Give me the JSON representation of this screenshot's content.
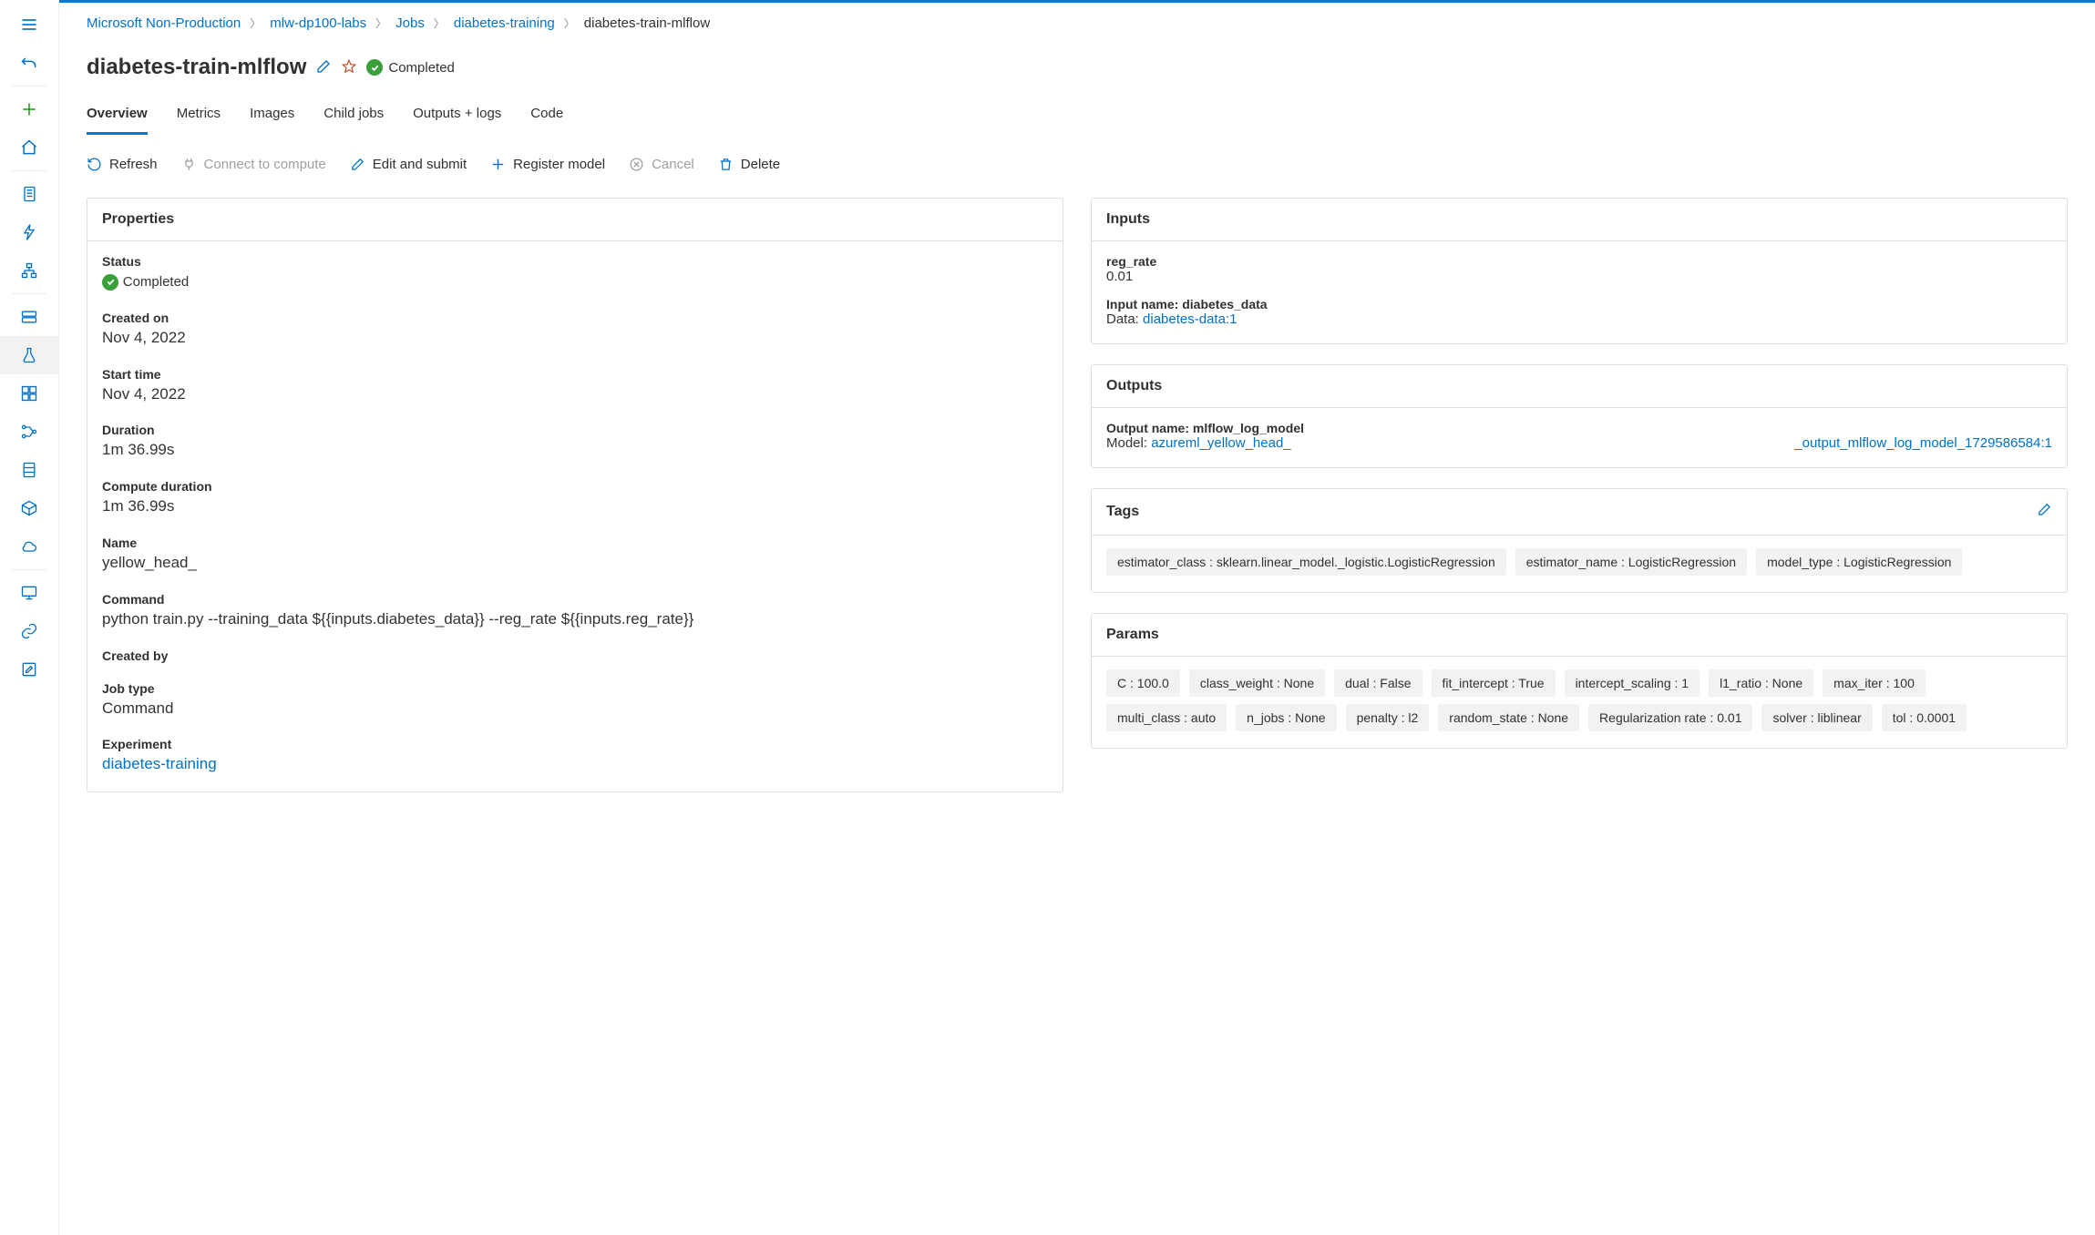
{
  "breadcrumb": [
    {
      "label": "Microsoft Non-Production",
      "link": true
    },
    {
      "label": "mlw-dp100-labs",
      "link": true
    },
    {
      "label": "Jobs",
      "link": true
    },
    {
      "label": "diabetes-training",
      "link": true
    },
    {
      "label": "diabetes-train-mlflow",
      "link": false
    }
  ],
  "title": "diabetes-train-mlflow",
  "status_label": "Completed",
  "tabs": {
    "overview": "Overview",
    "metrics": "Metrics",
    "images": "Images",
    "child_jobs": "Child jobs",
    "outputs_logs": "Outputs + logs",
    "code": "Code"
  },
  "actions": {
    "refresh": "Refresh",
    "connect": "Connect to compute",
    "edit_submit": "Edit and submit",
    "register_model": "Register model",
    "cancel": "Cancel",
    "delete": "Delete"
  },
  "headers": {
    "properties": "Properties",
    "inputs": "Inputs",
    "outputs": "Outputs",
    "tags": "Tags",
    "params": "Params"
  },
  "properties": {
    "status_label": "Status",
    "status_value": "Completed",
    "created_on_label": "Created on",
    "created_on_value": "Nov 4, 2022",
    "start_time_label": "Start time",
    "start_time_value": "Nov 4, 2022",
    "duration_label": "Duration",
    "duration_value": "1m 36.99s",
    "compute_duration_label": "Compute duration",
    "compute_duration_value": "1m 36.99s",
    "name_label": "Name",
    "name_value": "yellow_head_",
    "command_label": "Command",
    "command_value": "python train.py --training_data ${{inputs.diabetes_data}} --reg_rate ${{inputs.reg_rate}}",
    "created_by_label": "Created by",
    "created_by_value": "",
    "job_type_label": "Job type",
    "job_type_value": "Command",
    "experiment_label": "Experiment",
    "experiment_value": "diabetes-training"
  },
  "inputs": {
    "reg_rate_label": "reg_rate",
    "reg_rate_value": "0.01",
    "input_name_label": "Input name: diabetes_data",
    "data_prefix": "Data: ",
    "data_link": "diabetes-data:1"
  },
  "outputs": {
    "name_label": "Output name: mlflow_log_model",
    "model_prefix": "Model: ",
    "model_link_a": "azureml_yellow_head_",
    "model_link_b": "_output_mlflow_log_model_1729586584:1"
  },
  "tags_list": [
    "estimator_class : sklearn.linear_model._logistic.LogisticRegression",
    "estimator_name : LogisticRegression",
    "model_type : LogisticRegression"
  ],
  "params_list": [
    "C : 100.0",
    "class_weight : None",
    "dual : False",
    "fit_intercept : True",
    "intercept_scaling : 1",
    "l1_ratio : None",
    "max_iter : 100",
    "multi_class : auto",
    "n_jobs : None",
    "penalty : l2",
    "random_state : None",
    "Regularization rate : 0.01",
    "solver : liblinear",
    "tol : 0.0001"
  ]
}
